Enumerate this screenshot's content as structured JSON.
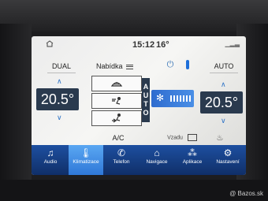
{
  "status": {
    "time": "15:12",
    "temp": "16°"
  },
  "controls": {
    "dual": "DUAL",
    "menu": "Nabídka",
    "auto": "AUTO",
    "auto_vertical": [
      "A",
      "U",
      "T",
      "O"
    ],
    "ac": "A/C",
    "recirc": "Vzadu"
  },
  "temps": {
    "left": "20.5°",
    "right": "20.5°"
  },
  "nav": [
    {
      "label": "Audio",
      "icon": "music-note-icon",
      "glyph": "♫"
    },
    {
      "label": "Klimatizace",
      "icon": "thermometer-icon",
      "glyph": "🌡"
    },
    {
      "label": "Telefon",
      "icon": "phone-icon",
      "glyph": "✆"
    },
    {
      "label": "Navigace",
      "icon": "navigation-icon",
      "glyph": "⌂"
    },
    {
      "label": "Aplikace",
      "icon": "apps-grid-icon",
      "glyph": "⁂"
    },
    {
      "label": "Nastavení",
      "icon": "settings-icon",
      "glyph": "⚙"
    }
  ],
  "watermark": "@ Bazos.sk"
}
